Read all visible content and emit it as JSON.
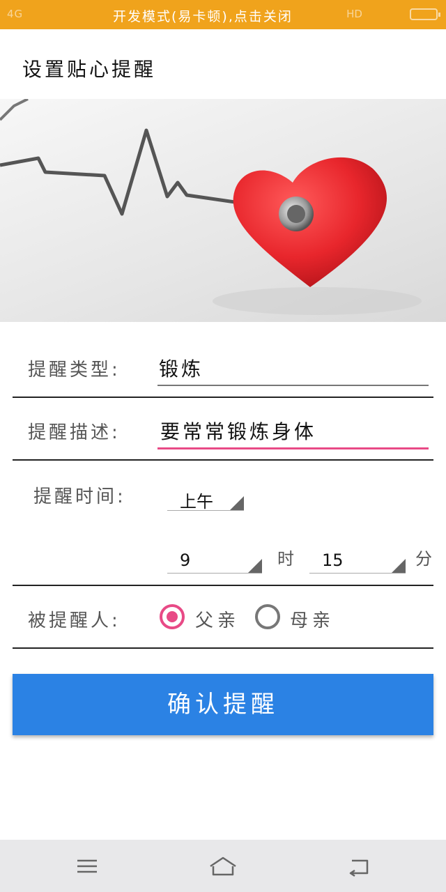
{
  "status_bar": {
    "signal": "4G",
    "dev_mode_notice": "开发模式(易卡顿),点击关闭",
    "hd": "HD"
  },
  "header": {
    "title": "设置贴心提醒"
  },
  "banner": {
    "icon": "heart-stethoscope-image",
    "colors": {
      "heart": "#e8262c",
      "line": "#555555"
    }
  },
  "form": {
    "type": {
      "label": "提醒类型:",
      "value": "锻炼"
    },
    "description": {
      "label": "提醒描述:",
      "value": "要常常锻炼身体"
    },
    "time": {
      "label": "提醒时间:",
      "period": "上午",
      "hour": "9",
      "hour_unit": "时",
      "minute": "15",
      "minute_unit": "分"
    },
    "recipient": {
      "label": "被提醒人:",
      "options": [
        {
          "label": "父亲",
          "selected": true
        },
        {
          "label": "母亲",
          "selected": false
        }
      ]
    }
  },
  "confirm_button": {
    "label": "确认提醒"
  },
  "colors": {
    "status_bar": "#f0a31c",
    "accent": "#e84a86",
    "button": "#2b82e4"
  },
  "nav": {
    "menu_icon": "menu-icon",
    "home_icon": "home-icon",
    "back_icon": "back-icon"
  }
}
